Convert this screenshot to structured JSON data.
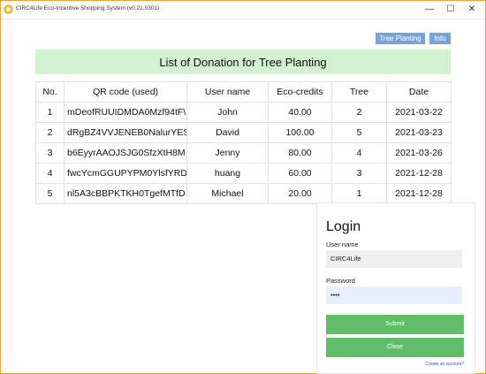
{
  "window": {
    "title": "CIRC4Life Eco-Incentive Shopping System (v0.21.0301)",
    "minimize": "—",
    "maximize": "☐",
    "close": "✕"
  },
  "nav": {
    "tree_planting": "Tree Planting",
    "info": "Info"
  },
  "page": {
    "title": "List of Donation for Tree Planting"
  },
  "table": {
    "headers": [
      "No.",
      "QR code (used)",
      "User name",
      "Eco-credits",
      "Tree",
      "Date"
    ],
    "rows": [
      [
        "1",
        "mDeofRUUIDMDA0Mzf94tF\\",
        "John",
        "40.00",
        "2",
        "2021-03-22"
      ],
      [
        "2",
        "dRgBZ4VVJENEB0NalurYES",
        "David",
        "100.00",
        "5",
        "2021-03-23"
      ],
      [
        "3",
        "b6EyyrAAOJSJG0SfzXtH8M",
        "Jenny",
        "80.00",
        "4",
        "2021-03-26"
      ],
      [
        "4",
        "fwcYcmGGUPYPM0YlsfYRD",
        "huang",
        "60.00",
        "3",
        "2021-12-28"
      ],
      [
        "5",
        "nl5A3cBBPKTKH0TgefMTfD",
        "Michael",
        "20.00",
        "1",
        "2021-12-28"
      ]
    ]
  },
  "login": {
    "title": "Login",
    "username_label": "User name",
    "username_value": "CIRC4Life",
    "password_label": "Password",
    "password_value": "••••",
    "submit": "Submit",
    "close": "Close",
    "create_account": "Create an account?"
  },
  "colors": {
    "window_border": "#f0a232",
    "nav_button": "#78a3d9",
    "banner": "#d2f1cf",
    "green_button": "#62bd6b"
  }
}
